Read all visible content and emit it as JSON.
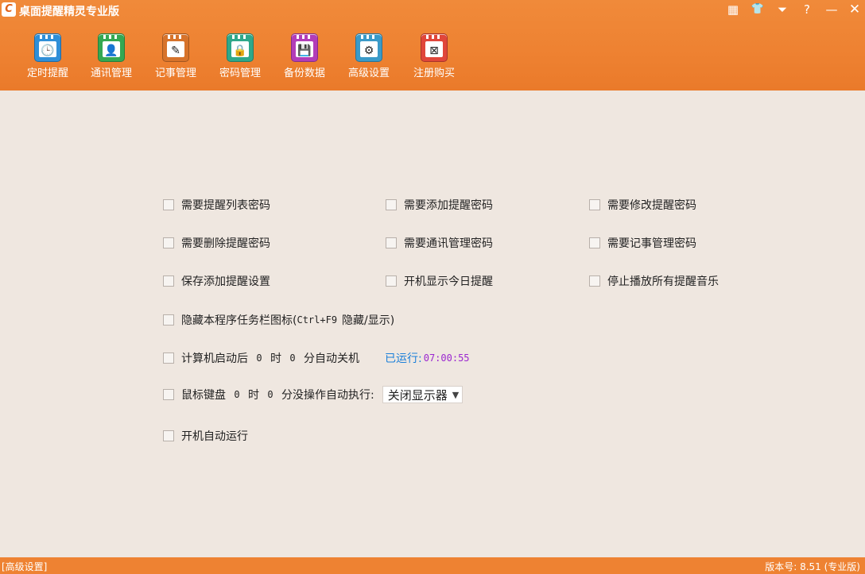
{
  "app": {
    "logo_letter": "C",
    "title": "桌面提醒精灵专业版"
  },
  "window_controls": [
    {
      "name": "calendar-icon",
      "glyph": "▦"
    },
    {
      "name": "skin-shirt-icon",
      "glyph": "👕"
    },
    {
      "name": "menu-dropdown-icon",
      "glyph": "⏷"
    },
    {
      "name": "help-icon",
      "glyph": "?"
    },
    {
      "name": "minimize-icon",
      "glyph": "—"
    },
    {
      "name": "close-icon",
      "glyph": "✕"
    }
  ],
  "toolbar": [
    {
      "label": "定时提醒",
      "icon": "alarm-clock-icon",
      "glyph": "🕒",
      "color": "#2f8fd8"
    },
    {
      "label": "通讯管理",
      "icon": "contacts-icon",
      "glyph": "👤",
      "color": "#34a852"
    },
    {
      "label": "记事管理",
      "icon": "notepad-icon",
      "glyph": "✎",
      "color": "#d7732b"
    },
    {
      "label": "密码管理",
      "icon": "password-lock-icon",
      "glyph": "🔒",
      "color": "#2fa88a"
    },
    {
      "label": "备份数据",
      "icon": "backup-disk-icon",
      "glyph": "💾",
      "color": "#b23db8"
    },
    {
      "label": "高级设置",
      "icon": "advanced-settings-gear-icon",
      "glyph": "⚙",
      "color": "#3a9ac8"
    },
    {
      "label": "注册购买",
      "icon": "register-purchase-icon",
      "glyph": "⊠",
      "color": "#e0463a"
    }
  ],
  "active_tab": "高级设置",
  "active_indicator_colors": [
    "#49b848",
    "#f0a030",
    "#e2489c"
  ],
  "settings": {
    "row1": [
      "需要提醒列表密码",
      "需要添加提醒密码",
      "需要修改提醒密码"
    ],
    "row2": [
      "需要删除提醒密码",
      "需要通讯管理密码",
      "需要记事管理密码"
    ],
    "row3": [
      "保存添加提醒设置",
      "开机显示今日提醒",
      "停止播放所有提醒音乐"
    ],
    "hide_taskbar": {
      "label": "隐藏本程序任务栏图标(",
      "shortcut": " Ctrl+F9 ",
      "suffix": "隐藏/显示)"
    },
    "auto_shutdown": {
      "prefix": "计算机启动后",
      "hours": "0",
      "hour_unit": "时",
      "minutes": "0",
      "suffix": "分自动关机",
      "runtime_label": "已运行:",
      "runtime_value": "07:00:55"
    },
    "idle_action": {
      "prefix": "鼠标键盘",
      "hours": "0",
      "hour_unit": "时",
      "minutes": "0",
      "suffix": "分没操作自动执行:",
      "selected": "关闭显示器"
    },
    "autostart": "开机自动运行"
  },
  "status": {
    "left": "[高级设置]",
    "right": "版本号: 8.51 (专业版)"
  }
}
